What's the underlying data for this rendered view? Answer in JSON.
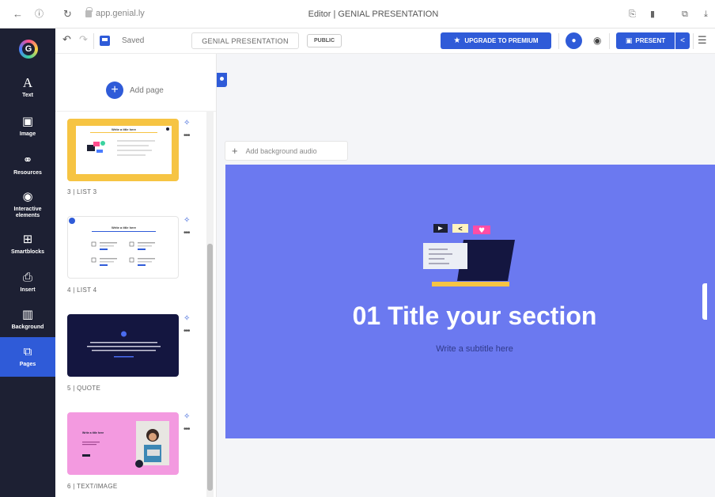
{
  "browser": {
    "url": "app.genial.ly",
    "title": "Editor | GENIAL PRESENTATION"
  },
  "toolbar": {
    "saved_label": "Saved",
    "title_field": "GENIAL PRESENTATION",
    "visibility": "PUBLIC",
    "upgrade_label": "UPGRADE TO PREMIUM",
    "present_label": "PRESENT"
  },
  "sidebar": {
    "items": [
      {
        "label": "Text",
        "icon": "text-icon"
      },
      {
        "label": "Image",
        "icon": "image-icon"
      },
      {
        "label": "Resources",
        "icon": "resources-icon"
      },
      {
        "label": "Interactive elements",
        "icon": "interactive-icon"
      },
      {
        "label": "Smartblocks",
        "icon": "smartblocks-icon"
      },
      {
        "label": "Insert",
        "icon": "insert-icon"
      },
      {
        "label": "Background",
        "icon": "background-icon"
      },
      {
        "label": "Pages",
        "icon": "pages-icon",
        "active": true
      }
    ]
  },
  "pages_panel": {
    "add_page_label": "Add page",
    "pages": [
      {
        "label": "3 | LIST 3",
        "thumb_title": "Write a title here"
      },
      {
        "label": "4 | LIST 4",
        "thumb_title": "Write a title here"
      },
      {
        "label": "5 | QUOTE"
      },
      {
        "label": "6 | TEXT/IMAGE",
        "thumb_title": "Write a title here"
      }
    ]
  },
  "canvas": {
    "add_audio_label": "Add background audio",
    "slide_title": "01 Title your section",
    "slide_subtitle": "Write a subtitle here"
  },
  "colors": {
    "accent": "#2f5bd8",
    "slide_bg": "#6b79f0",
    "sidebar_bg": "#1d2033"
  }
}
